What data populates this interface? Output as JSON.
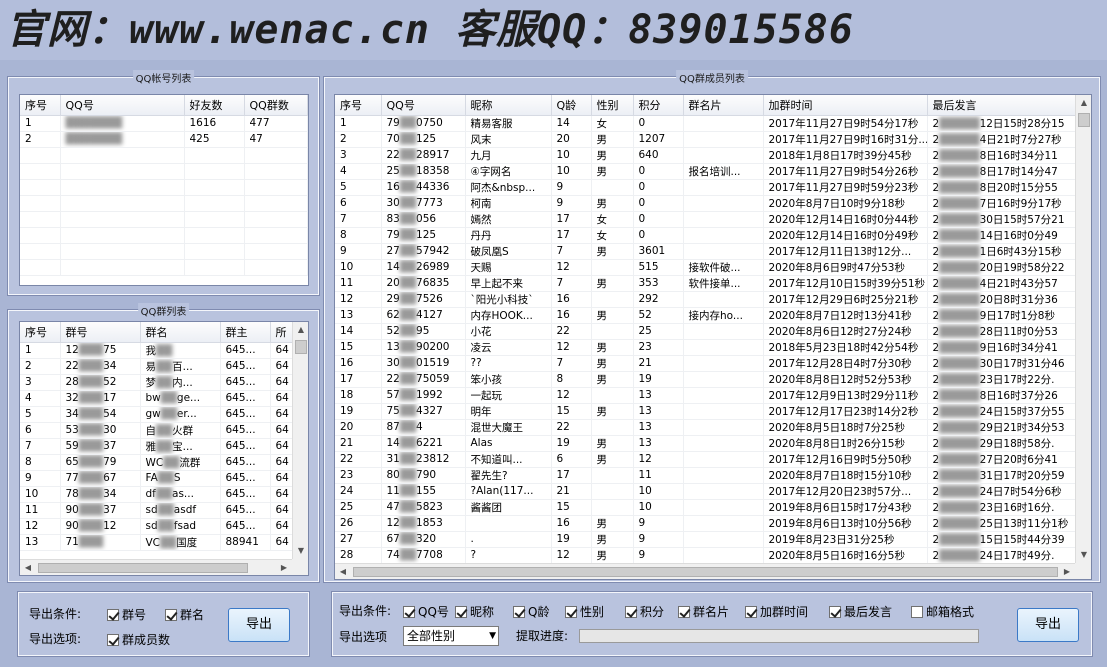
{
  "banner": "官网：www.wenac.cn 客服QQ：839015586",
  "accounts": {
    "title": "QQ帐号列表",
    "columns": [
      "序号",
      "QQ号",
      "好友数",
      "QQ群数"
    ],
    "rows": [
      [
        "1",
        "",
        "1616",
        "477"
      ],
      [
        "2",
        "",
        "425",
        "47"
      ]
    ]
  },
  "groups": {
    "title": "QQ群列表",
    "columns": [
      "序号",
      "群号",
      "群名",
      "群主",
      "所"
    ],
    "rows": [
      [
        "1",
        "12",
        "75",
        "我",
        "",
        "645...",
        "64"
      ],
      [
        "2",
        "22",
        "34",
        "易",
        "百...",
        "645...",
        "64"
      ],
      [
        "3",
        "28",
        "52",
        "梦",
        "内...",
        "645...",
        "64"
      ],
      [
        "4",
        "32",
        "17",
        "bw",
        "ge...",
        "645...",
        "64"
      ],
      [
        "5",
        "34",
        "54",
        "gw",
        "er...",
        "645...",
        "64"
      ],
      [
        "6",
        "53",
        "30",
        "自",
        "火群",
        "645...",
        "64"
      ],
      [
        "7",
        "59",
        "37",
        "雅",
        "宝...",
        "645...",
        "64"
      ],
      [
        "8",
        "65",
        "79",
        "WC",
        "流群",
        "645...",
        "64"
      ],
      [
        "9",
        "77",
        "67",
        "FA",
        "S",
        "645...",
        "64"
      ],
      [
        "10",
        "78",
        "34",
        "df",
        "as...",
        "645...",
        "64"
      ],
      [
        "11",
        "90",
        "37",
        "sd",
        "asdf",
        "645...",
        "64"
      ],
      [
        "12",
        "90",
        "12",
        "sd",
        "fsad",
        "645...",
        "64"
      ],
      [
        "13",
        "71",
        "",
        "VC",
        "国度",
        "88941",
        "64"
      ]
    ]
  },
  "group_export": {
    "cond_label": "导出条件:",
    "opt_label": "导出选项:",
    "checkboxes": [
      {
        "label": "群号",
        "checked": true
      },
      {
        "label": "群名",
        "checked": true
      },
      {
        "label": "群成员数",
        "checked": true
      }
    ],
    "button": "导出"
  },
  "members": {
    "title": "QQ群成员列表",
    "columns": [
      "序号",
      "QQ号",
      "昵称",
      "Q龄",
      "性别",
      "积分",
      "群名片",
      "加群时间",
      "最后发言"
    ],
    "rows": [
      [
        "1",
        "79",
        "0750",
        "精易客服",
        "14",
        "女",
        "0",
        "",
        "2017年11月27日9时54分17秒",
        "2",
        "12日15时28分15"
      ],
      [
        "2",
        "70",
        "125",
        "风末",
        "20",
        "男",
        "1207",
        "",
        "2017年11月27日9时16时31分...",
        "2",
        "4日21时7分27秒"
      ],
      [
        "3",
        "22",
        "28917",
        "九月",
        "10",
        "男",
        "640",
        "",
        "2018年1月8日17时39分45秒",
        "2",
        "8日16时34分11"
      ],
      [
        "4",
        "25",
        "18358",
        "④字网名",
        "10",
        "男",
        "0",
        "报名培训...",
        "2017年11月27日9时54分26秒",
        "2",
        "8日17时14分47"
      ],
      [
        "5",
        "16",
        "44336",
        "阿杰&nbsp...",
        "9",
        "",
        "0",
        "",
        "2017年11月27日9时59分23秒",
        "2",
        "8日20时15分55"
      ],
      [
        "6",
        "30",
        "7773",
        "柯南",
        "9",
        "男",
        "0",
        "",
        "2020年8月7日10时9分18秒",
        "2",
        "7日16时9分17秒"
      ],
      [
        "7",
        "83",
        "056",
        "嫣然",
        "17",
        "女",
        "0",
        "",
        "2020年12月14日16时0分44秒",
        "2",
        "30日15时57分21"
      ],
      [
        "8",
        "79",
        "125",
        "丹丹",
        "17",
        "女",
        "0",
        "",
        "2020年12月14日16时0分49秒",
        "2",
        "14日16时0分49"
      ],
      [
        "9",
        "27",
        "57942",
        "破凤凰S",
        "7",
        "男",
        "3601",
        "",
        "2017年12月11日13时12分...",
        "2",
        "1日6时43分15秒"
      ],
      [
        "10",
        "14",
        "26989",
        "天赐",
        "12",
        "",
        "515",
        "接软件破...",
        "2020年8月6日9时47分53秒",
        "2",
        "20日19时58分22"
      ],
      [
        "11",
        "20",
        "76835",
        "早上起不来",
        "7",
        "男",
        "353",
        "软件接单...",
        "2017年12月10日15时39分51秒",
        "2",
        "4日21时43分57"
      ],
      [
        "12",
        "29",
        "7526",
        "`阳光小科技`",
        "16",
        "",
        "292",
        "",
        "2017年12月29日6时25分21秒",
        "2",
        "20日8时31分36"
      ],
      [
        "13",
        "62",
        "4127",
        "内存HOOK...",
        "16",
        "男",
        "52",
        "接内存ho...",
        "2020年8月7日12时13分41秒",
        "2",
        "9日17时1分8秒"
      ],
      [
        "14",
        "52",
        "95",
        "小花",
        "22",
        "",
        "25",
        "",
        "2020年8月6日12时27分24秒",
        "2",
        "28日11时0分53"
      ],
      [
        "15",
        "13",
        "90200",
        "凌云",
        "12",
        "男",
        "23",
        "",
        "2018年5月23日18时42分54秒",
        "2",
        "9日16时34分41"
      ],
      [
        "16",
        "30",
        "01519",
        "??",
        "7",
        "男",
        "21",
        "",
        "2017年12月28日4时7分30秒",
        "2",
        "30日17时31分46"
      ],
      [
        "17",
        "22",
        "75059",
        "笨小孩",
        "8",
        "男",
        "19",
        "",
        "2020年8月8日12时52分53秒",
        "2",
        "23日17时22分."
      ],
      [
        "18",
        "57",
        "1992",
        "一起玩",
        "12",
        "",
        "13",
        "",
        "2017年12月9日13时29分11秒",
        "2",
        "8日16时37分26"
      ],
      [
        "19",
        "75",
        "4327",
        "明年",
        "15",
        "男",
        "13",
        "",
        "2017年12月17日23时14分2秒",
        "2",
        "24日15时37分55"
      ],
      [
        "20",
        "87",
        "4",
        "混世大魔王",
        "22",
        "",
        "13",
        "",
        "2020年8月5日18时7分25秒",
        "2",
        "29日21时34分53"
      ],
      [
        "21",
        "14",
        "6221",
        "Alas",
        "19",
        "男",
        "13",
        "",
        "2020年8月8日1时26分15秒",
        "2",
        "29日18时58分."
      ],
      [
        "22",
        "31",
        "23812",
        "不知道叫...",
        "6",
        "男",
        "12",
        "",
        "2017年12月16日9时5分50秒",
        "2",
        "27日20时6分41"
      ],
      [
        "23",
        "80",
        "790",
        "翟先生?",
        "17",
        "",
        "11",
        "",
        "2020年8月7日18时15分10秒",
        "2",
        "31日17时20分59"
      ],
      [
        "24",
        "11",
        "155",
        "?Alan(117...",
        "21",
        "",
        "10",
        "",
        "2017年12月20日23时57分...",
        "2",
        "24日7时54分6秒"
      ],
      [
        "25",
        "47",
        "5823",
        "酱酱团",
        "15",
        "",
        "10",
        "",
        "2019年8月6日15时17分43秒",
        "2",
        "23日16时16分."
      ],
      [
        "26",
        "12",
        "1853",
        "",
        "16",
        "男",
        "9",
        "",
        "2019年8月6日13时10分56秒",
        "2",
        "25日13时11分1秒"
      ],
      [
        "27",
        "67",
        "320",
        ".",
        "19",
        "男",
        "9",
        "",
        "2019年8月23日31分25秒",
        "2",
        "15日15时44分39"
      ],
      [
        "28",
        "74",
        "7708",
        "?",
        "12",
        "男",
        "9",
        "",
        "2020年8月5日16时16分5秒",
        "2",
        "24日17时49分."
      ]
    ]
  },
  "member_export": {
    "cond_label": "导出条件:",
    "opt_label": "导出选项",
    "checkboxes": [
      {
        "label": "QQ号",
        "checked": true
      },
      {
        "label": "昵称",
        "checked": true
      },
      {
        "label": "Q龄",
        "checked": true
      },
      {
        "label": "性别",
        "checked": true
      },
      {
        "label": "积分",
        "checked": true
      },
      {
        "label": "群名片",
        "checked": true
      },
      {
        "label": "加群时间",
        "checked": true
      },
      {
        "label": "最后发言",
        "checked": true
      },
      {
        "label": "邮箱格式",
        "checked": false
      }
    ],
    "select_value": "全部性别",
    "progress_label": "提取进度:",
    "progress": 0,
    "button": "导出"
  }
}
